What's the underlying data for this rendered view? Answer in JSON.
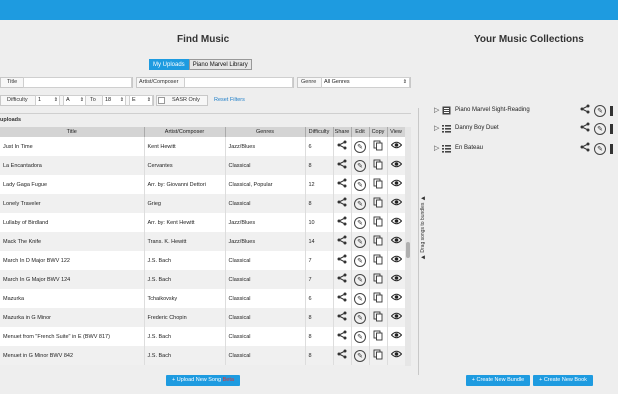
{
  "left_panel": {
    "title": "Find Music",
    "tabs": [
      {
        "label": "My Uploads"
      },
      {
        "label": "Piano Marvel Library"
      }
    ],
    "filters": {
      "title_label": "Title",
      "artist_label": "Artist/Composer",
      "genre_label": "Genre",
      "genre_value": "All Genres",
      "difficulty_label": "Difficulty",
      "from_num": "1",
      "from_letter": "A",
      "to_label": "To",
      "to_num": "18",
      "to_letter": "E",
      "sasr_label": "SASR Only",
      "reset_label": "Reset Filters"
    },
    "section_label": "uploads",
    "columns": [
      "Title",
      "Artist/Composer",
      "Genres",
      "Difficulty",
      "Share",
      "Edit",
      "Copy",
      "View"
    ],
    "rows": [
      {
        "title": "Just In Time",
        "artist": "Kent Hewitt",
        "genre": "Jazz/Blues",
        "difficulty": "6"
      },
      {
        "title": "La Encantadora",
        "artist": "Cervantes",
        "genre": "Classical",
        "difficulty": "8"
      },
      {
        "title": "Lady Gaga Fugue",
        "artist": "Arr. by: Giovanni Dettori",
        "genre": "Classical, Popular",
        "difficulty": "12"
      },
      {
        "title": "Lonely Traveler",
        "artist": "Grieg",
        "genre": "Classical",
        "difficulty": "8"
      },
      {
        "title": "Lullaby of Birdland",
        "artist": "Arr. by: Kent Hewitt",
        "genre": "Jazz/Blues",
        "difficulty": "10"
      },
      {
        "title": "Mack The Knife",
        "artist": "Trans. K. Hewitt",
        "genre": "Jazz/Blues",
        "difficulty": "14"
      },
      {
        "title": "March In D Major BWV 122",
        "artist": "J.S. Bach",
        "genre": "Classical",
        "difficulty": "7"
      },
      {
        "title": "March In G Major BWV 124",
        "artist": "J.S. Bach",
        "genre": "Classical",
        "difficulty": "7"
      },
      {
        "title": "Mazurka",
        "artist": "Tchaikovsky",
        "genre": "Classical",
        "difficulty": "6"
      },
      {
        "title": "Mazurka in G Minor",
        "artist": "Frederic Chopin",
        "genre": "Classical",
        "difficulty": "8"
      },
      {
        "title": "Menuet from \"French Suite\" in E (BWV 817)",
        "artist": "J.S. Bach",
        "genre": "Classical",
        "difficulty": "8"
      },
      {
        "title": "Menuet in G Minor BWV 842",
        "artist": "J.S. Bach",
        "genre": "Classical",
        "difficulty": "8"
      }
    ],
    "drag_hint": "Drag songs to bundles",
    "upload_label": "+ Upload New Song",
    "upload_badge": "Beta"
  },
  "right_panel": {
    "title": "Your Music Collections",
    "collections": [
      {
        "name": "Piano Marvel Sight-Reading",
        "icon": "book-icon"
      },
      {
        "name": "Danny Boy Duet",
        "icon": "list-icon"
      },
      {
        "name": "En Bateau",
        "icon": "list-icon"
      }
    ],
    "create_bundle_label": "+ Create New Bundle",
    "create_book_label": "+ Create New Book"
  },
  "colors": {
    "accent": "#1e9be0",
    "badge": "#e8322e"
  }
}
